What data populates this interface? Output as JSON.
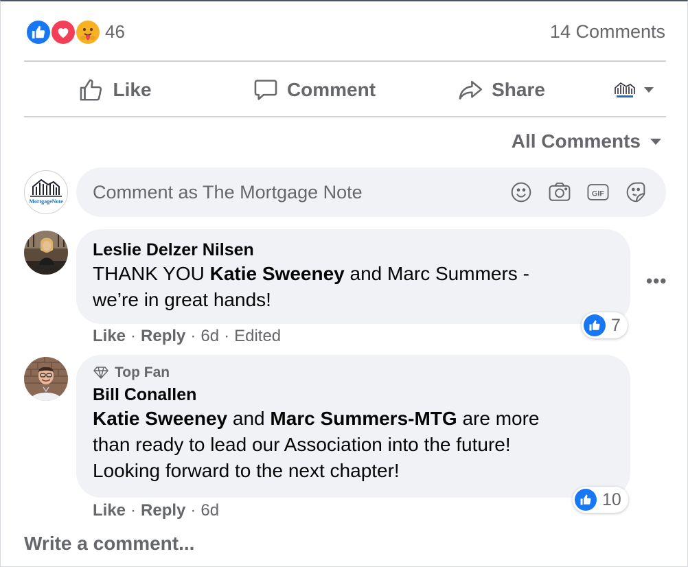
{
  "summary": {
    "reaction_count": "46",
    "comments_count": "14 Comments",
    "reaction_icons": [
      "like-icon",
      "love-icon",
      "care-icon"
    ]
  },
  "actions": {
    "like_label": "Like",
    "comment_label": "Comment",
    "share_label": "Share",
    "page_logo_icon": "mortgage-note-logo-icon"
  },
  "filter": {
    "label": "All Comments"
  },
  "composer": {
    "placeholder": "Comment as The Mortgage Note",
    "tools": [
      "emoji-icon",
      "camera-icon",
      "gif-icon",
      "sticker-icon"
    ]
  },
  "logo": {
    "text": "MortgageNote"
  },
  "comments": [
    {
      "author": "Leslie Delzer Nilsen",
      "text_parts": [
        "THANK YOU ",
        "Katie Sweeney",
        " and Marc Summers -",
        "we’re in great hands!"
      ],
      "reaction_count": "7",
      "like_label": "Like",
      "reply_label": "Reply",
      "time": "6d",
      "edited": "Edited",
      "more": "•••"
    },
    {
      "badge": "Top Fan",
      "author": "Bill Conallen",
      "text_parts": [
        "Katie Sweeney",
        " and ",
        "Marc Summers-MTG",
        " are more",
        "than ready to lead our Association into the future!",
        "Looking forward to the next chapter!"
      ],
      "reaction_count": "10",
      "like_label": "Like",
      "reply_label": "Reply",
      "time": "6d"
    }
  ],
  "footer": {
    "write_label": "Write a comment..."
  },
  "colors": {
    "accent": "#1877f2",
    "love": "#f33e58",
    "care": "#f7b125",
    "muted": "#65676b",
    "bubble": "#f0f2f5"
  },
  "separator": "·"
}
